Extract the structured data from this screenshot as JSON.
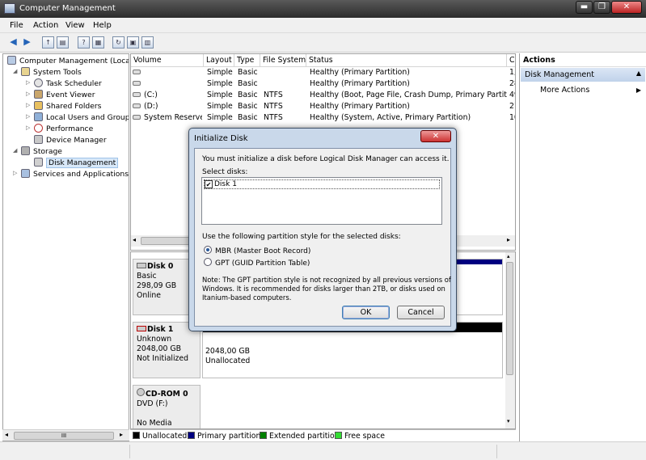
{
  "window": {
    "title": "Computer Management",
    "controls": [
      "▬",
      "❐",
      "✕"
    ]
  },
  "menu": [
    "File",
    "Action",
    "View",
    "Help"
  ],
  "tree": {
    "items": [
      {
        "label": "Computer Management (Local",
        "level": 0
      },
      {
        "label": "System Tools",
        "level": 1
      },
      {
        "label": "Task Scheduler",
        "level": 2
      },
      {
        "label": "Event Viewer",
        "level": 2
      },
      {
        "label": "Shared Folders",
        "level": 2
      },
      {
        "label": "Local Users and Groups",
        "level": 2
      },
      {
        "label": "Performance",
        "level": 2
      },
      {
        "label": "Device Manager",
        "level": 2
      },
      {
        "label": "Storage",
        "level": 1
      },
      {
        "label": "Disk Management",
        "level": 2
      },
      {
        "label": "Services and Applications",
        "level": 1
      }
    ],
    "scroll_grip": "III"
  },
  "volumes": {
    "columns": [
      "Volume",
      "Layout",
      "Type",
      "File System",
      "Status",
      "C"
    ],
    "rows": [
      {
        "volume": "",
        "layout": "Simple",
        "type": "Basic",
        "fs": "",
        "status": "Healthy (Primary Partition)",
        "cap": "1,"
      },
      {
        "volume": "",
        "layout": "Simple",
        "type": "Basic",
        "fs": "",
        "status": "Healthy (Primary Partition)",
        "cap": "28"
      },
      {
        "volume": "(C:)",
        "layout": "Simple",
        "type": "Basic",
        "fs": "NTFS",
        "status": "Healthy (Boot, Page File, Crash Dump, Primary Partition)",
        "cap": "49"
      },
      {
        "volume": "(D:)",
        "layout": "Simple",
        "type": "Basic",
        "fs": "NTFS",
        "status": "Healthy (Primary Partition)",
        "cap": "21"
      },
      {
        "volume": "System Reserved",
        "layout": "Simple",
        "type": "Basic",
        "fs": "NTFS",
        "status": "Healthy (System, Active, Primary Partition)",
        "cap": "10"
      }
    ]
  },
  "disks": [
    {
      "name": "Disk 0",
      "lines": [
        "Basic",
        "298,09 GB",
        "Online"
      ]
    },
    {
      "name": "Disk 1",
      "lines": [
        "Unknown",
        "2048,00 GB",
        "Not Initialized"
      ],
      "part_size": "2048,00 GB",
      "part_state": "Unallocated"
    },
    {
      "name": "CD-ROM 0",
      "lines": [
        "DVD (F:)",
        "",
        "No Media"
      ]
    }
  ],
  "legend": [
    {
      "label": "Unallocated",
      "color": "#000000"
    },
    {
      "label": "Primary partition",
      "color": "#000080"
    },
    {
      "label": "Extended partition",
      "color": "#008000"
    },
    {
      "label": "Free space",
      "color": "#33dd33"
    }
  ],
  "actions": {
    "header": "Actions",
    "section": "Disk Management",
    "item": "More Actions"
  },
  "dialog": {
    "title": "Initialize Disk",
    "intro": "You must initialize a disk before Logical Disk Manager can access it.",
    "select_label": "Select disks:",
    "disks": [
      {
        "label": "Disk 1",
        "checked": true
      }
    ],
    "style_label": "Use the following partition style for the selected disks:",
    "options": [
      {
        "label": "MBR (Master Boot Record)",
        "selected": true
      },
      {
        "label": "GPT (GUID Partition Table)",
        "selected": false
      }
    ],
    "note": [
      "Note: The GPT partition style is not recognized by all previous versions of",
      "Windows. It is recommended for disks larger than 2TB, or disks used on",
      "Itanium-based computers."
    ],
    "ok": "OK",
    "cancel": "Cancel",
    "close": "✕"
  }
}
